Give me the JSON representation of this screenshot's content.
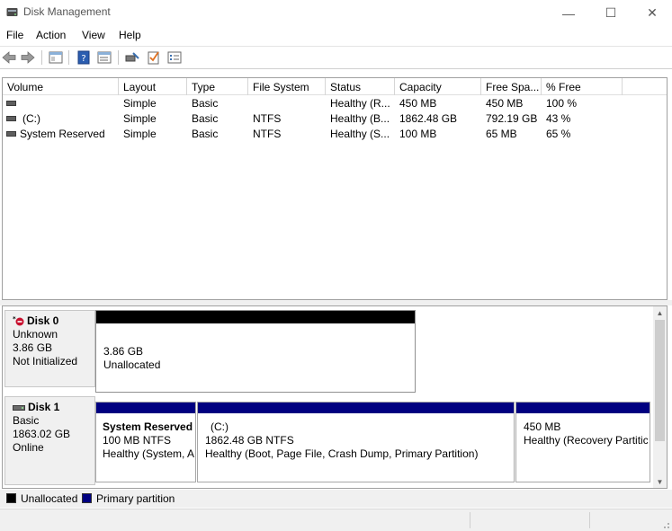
{
  "window": {
    "title": "Disk Management",
    "minimize_glyph": "—",
    "maximize_glyph": "☐",
    "close_glyph": "✕"
  },
  "menu": [
    "File",
    "Action",
    "View",
    "Help"
  ],
  "toolbar": {
    "icons": [
      "back-icon",
      "forward-icon",
      "console-tree-icon",
      "help-icon",
      "properties-icon",
      "rescan-icon",
      "checklist-icon",
      "settings-list-icon"
    ]
  },
  "columns": [
    "Volume",
    "Layout",
    "Type",
    "File System",
    "Status",
    "Capacity",
    "Free Spa...",
    "% Free"
  ],
  "volumes": [
    {
      "volume": "",
      "layout": "Simple",
      "type": "Basic",
      "fs": "",
      "status": "Healthy (R...",
      "capacity": "450 MB",
      "free": "450 MB",
      "pct": "100 %"
    },
    {
      "volume": "(C:)",
      "layout": "Simple",
      "type": "Basic",
      "fs": "NTFS",
      "status": "Healthy (B...",
      "capacity": "1862.48 GB",
      "free": "792.19 GB",
      "pct": "43 %"
    },
    {
      "volume": "System Reserved",
      "layout": "Simple",
      "type": "Basic",
      "fs": "NTFS",
      "status": "Healthy (S...",
      "capacity": "100 MB",
      "free": "65 MB",
      "pct": "65 %"
    }
  ],
  "disks": [
    {
      "name": "Disk 0",
      "type": "Unknown",
      "size": "3.86 GB",
      "state": "Not Initialized",
      "icon": "disk-error-icon",
      "partitions": [
        {
          "line1": "",
          "line2": "3.86 GB",
          "line3": "Unallocated",
          "kind": "unallocated"
        }
      ]
    },
    {
      "name": "Disk 1",
      "type": "Basic",
      "size": "1863.02 GB",
      "state": "Online",
      "icon": "disk-icon",
      "partitions": [
        {
          "line1": "System Reserved",
          "line2": "100 MB NTFS",
          "line3": "Healthy (System, A",
          "kind": "primary"
        },
        {
          "line1": "(C:)",
          "line2": "1862.48 GB NTFS",
          "line3": "Healthy (Boot, Page File, Crash Dump, Primary Partition)",
          "kind": "primary"
        },
        {
          "line1": "",
          "line2": "450 MB",
          "line3": "Healthy (Recovery Partitic",
          "kind": "primary"
        }
      ]
    }
  ],
  "legend": [
    {
      "label": "Unallocated",
      "color": "#000000"
    },
    {
      "label": "Primary partition",
      "color": "#000080"
    }
  ],
  "colors": {
    "unallocated": "#000000",
    "primary": "#000080"
  }
}
